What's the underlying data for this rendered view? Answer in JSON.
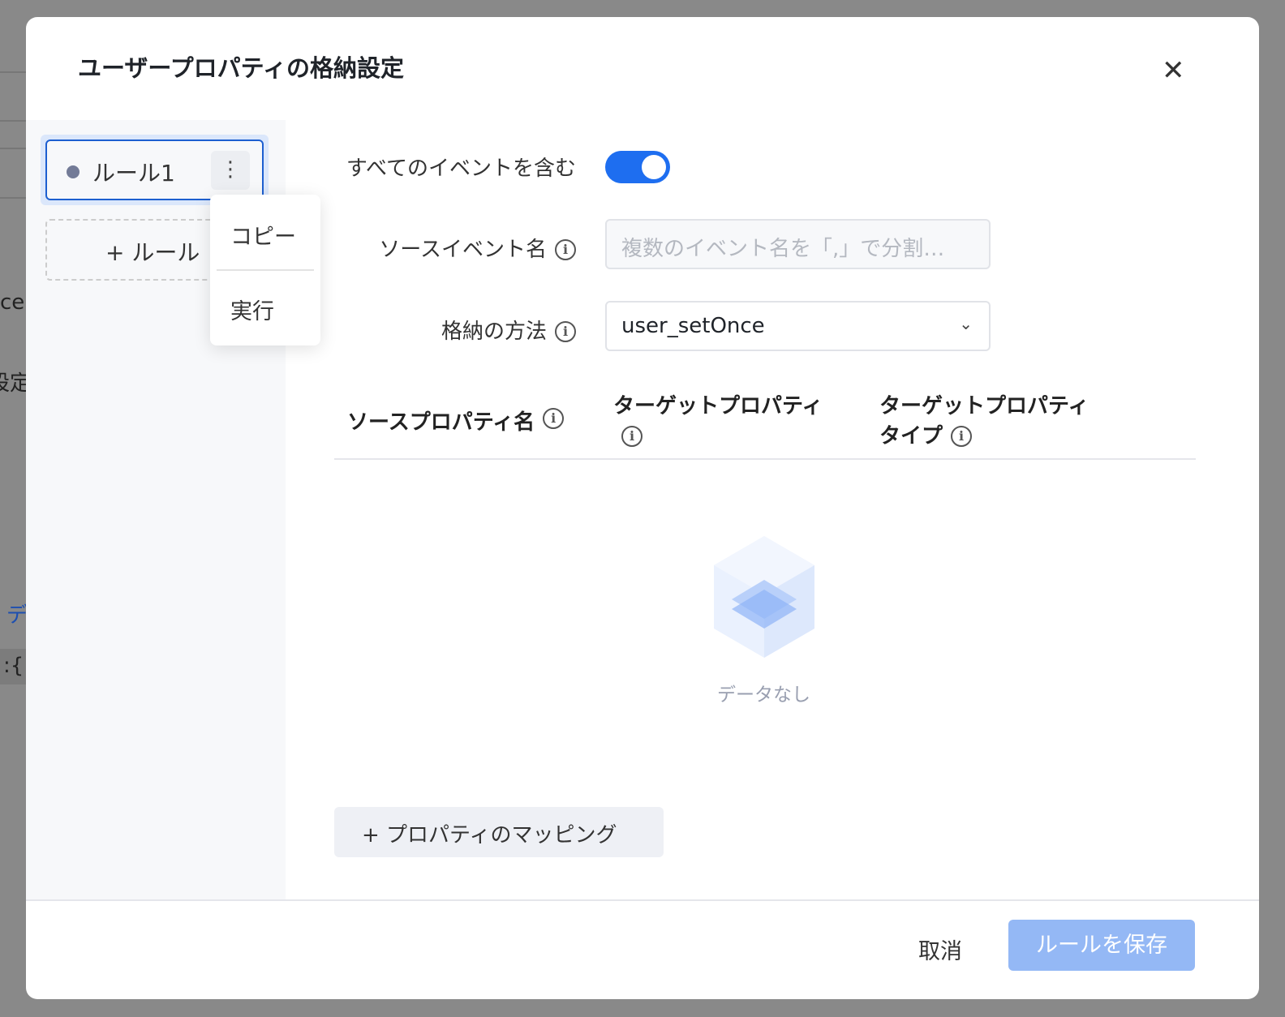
{
  "background": {
    "fragments": [
      "ce",
      "設定",
      "デ",
      ":{"
    ]
  },
  "dialog": {
    "title": "ユーザープロパティの格納設定",
    "close_icon": "close-icon"
  },
  "sidebar": {
    "rules": [
      {
        "label": "ルール1"
      }
    ],
    "add_rule_label": "+ ルール",
    "context_menu": [
      "コピー",
      "実行"
    ]
  },
  "form": {
    "include_all_events_label": "すべてのイベントを含む",
    "include_all_events": true,
    "source_event_label": "ソースイベント名",
    "source_event_placeholder": "複数のイベント名を「,」で分割…",
    "storage_method_label": "格納の方法",
    "storage_method_value": "user_setOnce"
  },
  "table": {
    "headers": [
      "ソースプロパティ名",
      "ターゲットプロパティ",
      "ターゲットプロパティタイプ"
    ],
    "header_lines": {
      "target_type_1": "ターゲットプロパティ",
      "target_type_2": "タイプ"
    },
    "empty_text": "データなし"
  },
  "map_button_label": "+ プロパティのマッピング",
  "footer": {
    "cancel": "取消",
    "save": "ルールを保存"
  },
  "colors": {
    "accent": "#1e6ef0",
    "save_disabled": "#94b8f5"
  }
}
